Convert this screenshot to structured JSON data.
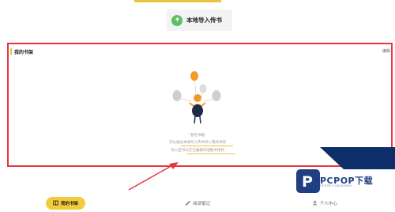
{
  "header": {
    "import_button_label": "本地导入传书"
  },
  "bookshelf": {
    "title": "我的书架",
    "edit_label": "编辑",
    "empty": {
      "title": "暂无书籍",
      "line1": "可以通过本地导入传书导入我的书架",
      "line2": "导入后可以在已编辑对话框中找到"
    }
  },
  "bottom_nav": {
    "items": [
      {
        "label": "我的书架",
        "icon": "book-icon",
        "active": true
      },
      {
        "label": "阅读笔记",
        "icon": "pencil-icon",
        "active": false
      },
      {
        "label": "个人中心",
        "icon": "person-icon",
        "active": false
      }
    ]
  },
  "watermark": {
    "brand": "PCPOP下载",
    "sub": "PCPOP.COM/DOWN"
  },
  "colors": {
    "accent": "#f4cc3a",
    "highlight": "#e8343f",
    "import_icon": "#5cbf66",
    "balloon": "#f39a2b"
  }
}
